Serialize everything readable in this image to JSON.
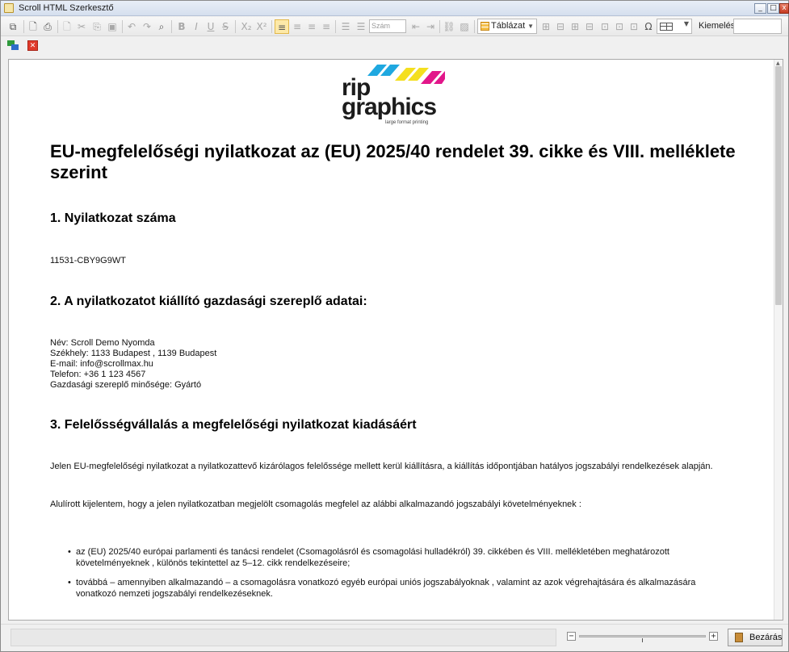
{
  "window": {
    "title": "Scroll HTML Szerkesztő",
    "minimize": "_",
    "maximize": "□",
    "close": "x"
  },
  "toolbar": {
    "number_placeholder": "Szám",
    "table_label": "Táblázat",
    "highlight_label": "Kiemelés:",
    "highlight_value": ""
  },
  "toolbar2": {
    "close_glyph": "✕"
  },
  "document": {
    "logo_word1": "rip",
    "logo_word2": "graphics",
    "logo_tagline": "large format printing",
    "title": "EU-megfelelőségi nyilatkozat az (EU) 2025/40 rendelet 39. cikke és VIII. melléklete szerint",
    "section1_heading": "1. Nyilatkozat száma",
    "declaration_number": "11531-CBY9G9WT",
    "section2_heading": "2. A nyilatkozatot kiállító gazdasági szereplő adatai:",
    "operator_lines": [
      "Név:  Scroll Demo Nyomda",
      "Székhely:  1133 Budapest , 1139 Budapest",
      "E-mail: info@scrollmax.hu",
      "Telefon: +36 1 123 4567",
      "Gazdasági szereplő minősége: Gyártó"
    ],
    "section3_heading": "3. Felelősségvállalás a megfelelőségi nyilatkozat kiadásáért",
    "paragraph1": "Jelen EU-megfelelőségi  nyilatkozat  a nyilatkozattevő  kizárólagos  felelőssége  mellett kerül kiállításra, a kiállítás időpontjában  hatályos  jogszabályi  rendelkezések alapján.",
    "paragraph2": "Alulírott kijelentem, hogy  a jelen nyilatkozatban  megjelölt  csomagolás  megfelel az alábbi alkalmazandó  jogszabályi  követelményeknek :",
    "bullets": [
      "az (EU) 2025/40 európai parlamenti és tanácsi rendelet (Csomagolásról  és csomagolási  hulladékról) 39. cikkében és VIII. mellékletében meghatározott követelményeknek , különös tekintettel az 5–12. cikk  rendelkezéseire;",
      "továbbá – amennyiben alkalmazandó – a csomagolásra   vonatkozó  egyéb  európai uniós  jogszabályoknak , valamint az azok végrehajtására és alkalmazására vonatkozó nemzeti jogszabályi  rendelkezéseknek."
    ]
  },
  "statusbar": {
    "zoom_minus": "−",
    "zoom_plus": "+",
    "zoom_level_percent": 50,
    "close_button": "Bezárás"
  },
  "colors": {
    "logo_cyan": "#1fa8e0",
    "logo_yellow": "#f4df1f",
    "logo_magenta": "#e2168a",
    "active_button": "#fde9a8"
  }
}
